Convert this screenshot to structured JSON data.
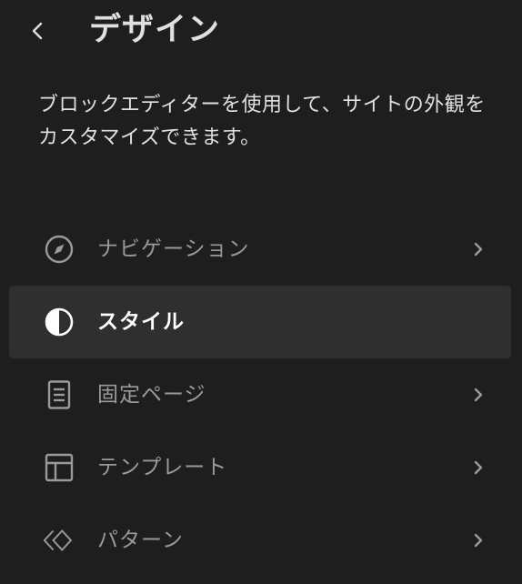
{
  "header": {
    "title": "デザイン",
    "back_icon": "chevron-left-icon"
  },
  "description": "ブロックエディターを使用して、サイトの外観をカスタマイズできます。",
  "menu": {
    "items": [
      {
        "label": "ナビゲーション",
        "icon": "navigation-compass-icon",
        "active": false,
        "has_chevron": true
      },
      {
        "label": "スタイル",
        "icon": "half-circle-style-icon",
        "active": true,
        "has_chevron": false
      },
      {
        "label": "固定ページ",
        "icon": "page-icon",
        "active": false,
        "has_chevron": true
      },
      {
        "label": "テンプレート",
        "icon": "layout-template-icon",
        "active": false,
        "has_chevron": true
      },
      {
        "label": "パターン",
        "icon": "symbol-pattern-icon",
        "active": false,
        "has_chevron": true
      }
    ]
  },
  "colors": {
    "background": "#1e1e1e",
    "active_item_background": "#2f2f2f",
    "text_primary": "#e0e0e0",
    "text_muted": "#9a9a9a",
    "text_active": "#ffffff"
  }
}
